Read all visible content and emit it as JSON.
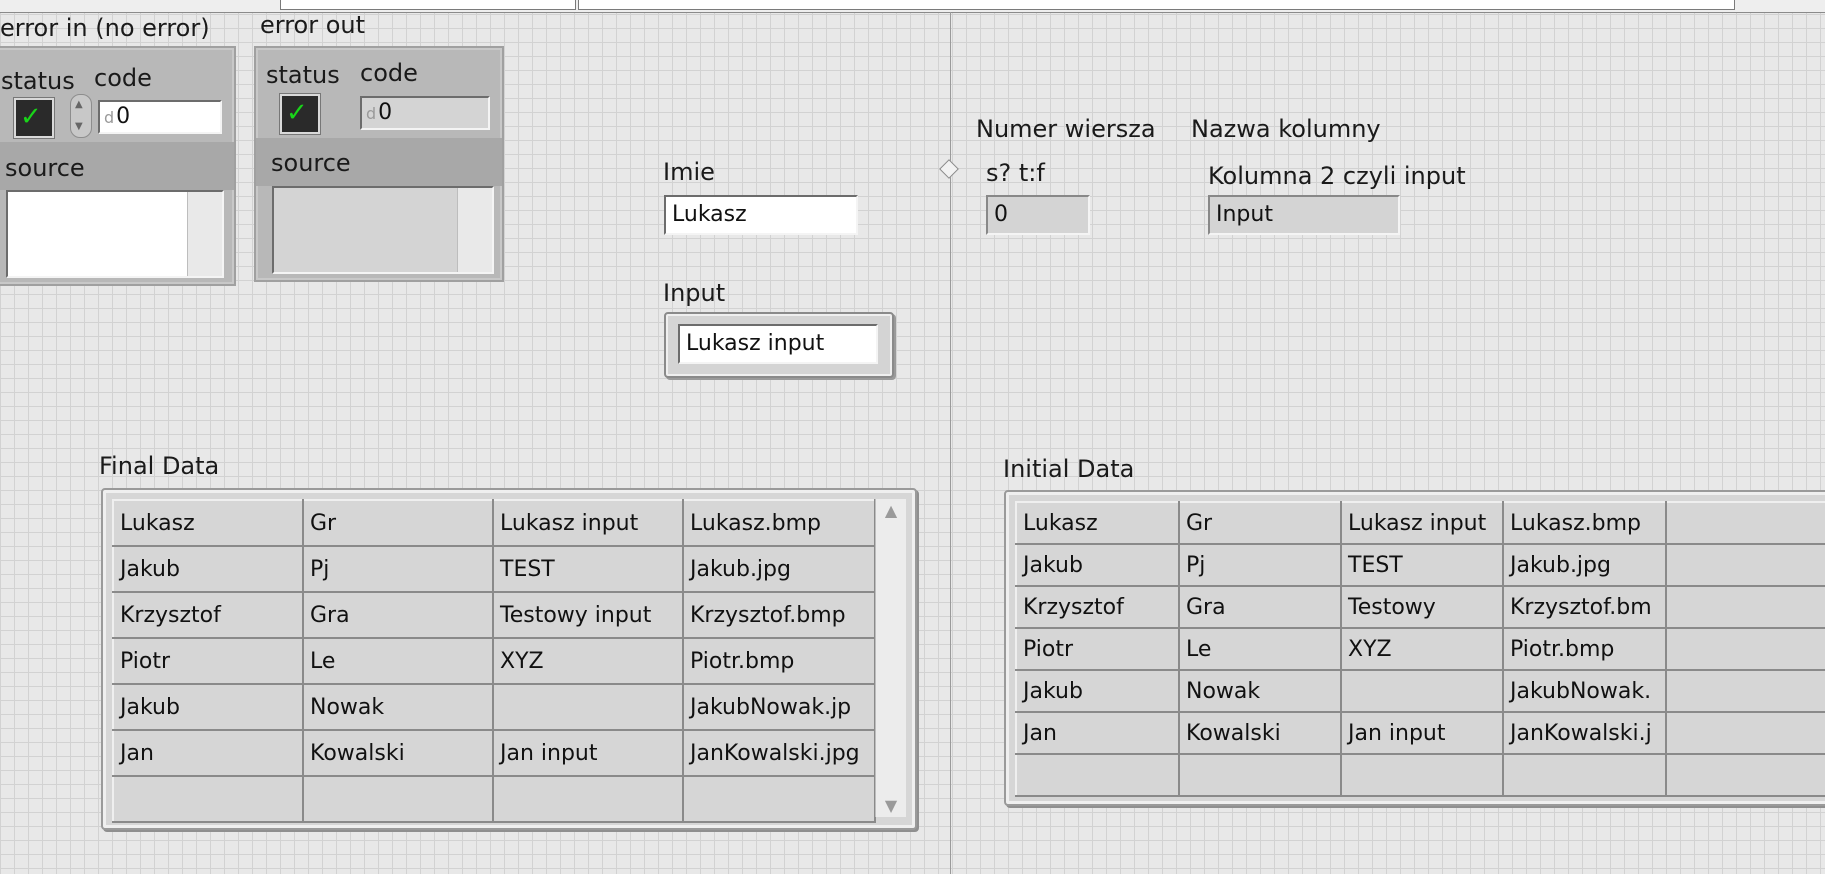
{
  "error_in": {
    "title": "error in (no error)",
    "status_label": "status",
    "code_label": "code",
    "code_value": "0",
    "source_label": "source",
    "status_check": "✓"
  },
  "error_out": {
    "title": "error out",
    "status_label": "status",
    "code_label": "code",
    "code_value": "0",
    "source_label": "source",
    "status_check": "✓"
  },
  "imie": {
    "label": "Imie",
    "value": "Lukasz"
  },
  "input": {
    "label": "Input",
    "value": "Lukasz input"
  },
  "numer_wiersza": {
    "label": "Numer wiersza",
    "sublabel": "s? t:f",
    "value": "0"
  },
  "nazwa_kolumny": {
    "label": "Nazwa kolumny",
    "sublabel": "Kolumna 2 czyli input",
    "value": "Input"
  },
  "final_data": {
    "label": "Final Data",
    "rows": [
      [
        "Lukasz",
        "Gr",
        "Lukasz input",
        "Lukasz.bmp"
      ],
      [
        "Jakub",
        "Pj",
        "TEST",
        "Jakub.jpg"
      ],
      [
        "Krzysztof",
        "Gra",
        "Testowy input",
        "Krzysztof.bmp"
      ],
      [
        "Piotr",
        "Le",
        "XYZ",
        "Piotr.bmp"
      ],
      [
        "Jakub",
        "Nowak",
        "",
        "JakubNowak.jp"
      ],
      [
        "Jan",
        "Kowalski",
        "Jan input",
        "JanKowalski.jpg"
      ],
      [
        "",
        "",
        "",
        ""
      ]
    ]
  },
  "initial_data": {
    "label": "Initial Data",
    "rows": [
      [
        "Lukasz",
        "Gr",
        "Lukasz input",
        "Lukasz.bmp",
        ""
      ],
      [
        "Jakub",
        "Pj",
        "TEST",
        "Jakub.jpg",
        ""
      ],
      [
        "Krzysztof",
        "Gra",
        "Testowy",
        "Krzysztof.bm",
        ""
      ],
      [
        "Piotr",
        "Le",
        "XYZ",
        "Piotr.bmp",
        ""
      ],
      [
        "Jakub",
        "Nowak",
        "",
        "JakubNowak.",
        ""
      ],
      [
        "Jan",
        "Kowalski",
        "Jan input",
        "JanKowalski.j",
        ""
      ],
      [
        "",
        "",
        "",
        "",
        ""
      ]
    ]
  },
  "colors": {
    "led_green": "#19d419",
    "panel_bg": "#e8e8e8",
    "grid_line": "#d2d2d2"
  }
}
